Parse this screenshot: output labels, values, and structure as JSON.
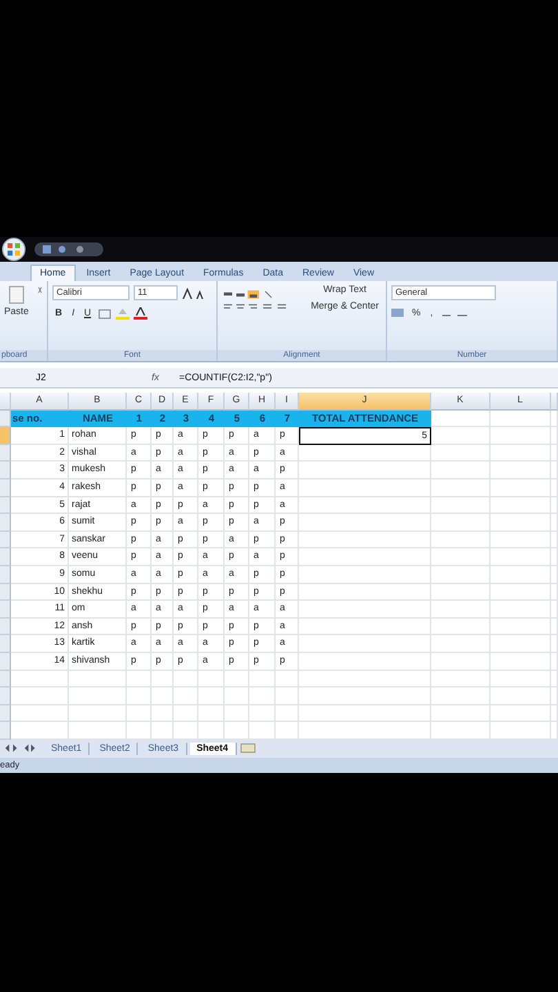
{
  "ribbon": {
    "tabs": [
      {
        "label": "Home",
        "selected": true
      },
      {
        "label": "Insert",
        "selected": false
      },
      {
        "label": "Page Layout",
        "selected": false
      },
      {
        "label": "Formulas",
        "selected": false
      },
      {
        "label": "Data",
        "selected": false
      },
      {
        "label": "Review",
        "selected": false
      },
      {
        "label": "View",
        "selected": false
      }
    ],
    "clipboard": {
      "paste": "Paste",
      "group_label": "pboard"
    },
    "font": {
      "name": "Calibri",
      "size": "11",
      "bold": "B",
      "italic": "I",
      "underline": "U",
      "group_label": "Font"
    },
    "alignment": {
      "wrap": "Wrap Text",
      "merge": "Merge & Center",
      "group_label": "Alignment"
    },
    "number": {
      "format": "General",
      "percent": "%",
      "comma": ",",
      "group_label": "Number"
    }
  },
  "formula_bar": {
    "name_box": "J2",
    "fx": "fx",
    "formula": "=COUNTIF(C2:I2,\"p\")"
  },
  "sheet": {
    "columns": [
      {
        "label": "A",
        "selected": false
      },
      {
        "label": "B",
        "selected": false
      },
      {
        "label": "C",
        "selected": false
      },
      {
        "label": "D",
        "selected": false
      },
      {
        "label": "E",
        "selected": false
      },
      {
        "label": "F",
        "selected": false
      },
      {
        "label": "G",
        "selected": false
      },
      {
        "label": "H",
        "selected": false
      },
      {
        "label": "I",
        "selected": false
      },
      {
        "label": "J",
        "selected": true
      },
      {
        "label": "K",
        "selected": false
      },
      {
        "label": "L",
        "selected": false
      }
    ],
    "header_row": [
      "se no.",
      "NAME",
      "1",
      "2",
      "3",
      "4",
      "5",
      "6",
      "7",
      "TOTAL ATTENDANCE"
    ],
    "rows": [
      {
        "no": "1",
        "name": "rohan",
        "marks": [
          "p",
          "p",
          "a",
          "p",
          "p",
          "a",
          "p"
        ],
        "total": "5",
        "selected": true
      },
      {
        "no": "2",
        "name": "vishal",
        "marks": [
          "a",
          "p",
          "a",
          "p",
          "a",
          "p",
          "a"
        ],
        "selected": false
      },
      {
        "no": "3",
        "name": "mukesh",
        "marks": [
          "p",
          "a",
          "a",
          "p",
          "a",
          "a",
          "p"
        ],
        "selected": false
      },
      {
        "no": "4",
        "name": "rakesh",
        "marks": [
          "p",
          "p",
          "a",
          "p",
          "p",
          "p",
          "a"
        ],
        "selected": false
      },
      {
        "no": "5",
        "name": "rajat",
        "marks": [
          "a",
          "p",
          "p",
          "a",
          "p",
          "p",
          "a"
        ],
        "selected": false
      },
      {
        "no": "6",
        "name": "sumit",
        "marks": [
          "p",
          "p",
          "a",
          "p",
          "p",
          "a",
          "p"
        ],
        "selected": false
      },
      {
        "no": "7",
        "name": "sanskar",
        "marks": [
          "p",
          "a",
          "p",
          "p",
          "a",
          "p",
          "p"
        ],
        "selected": false
      },
      {
        "no": "8",
        "name": "veenu",
        "marks": [
          "p",
          "a",
          "p",
          "a",
          "p",
          "a",
          "p"
        ],
        "selected": false
      },
      {
        "no": "9",
        "name": "somu",
        "marks": [
          "a",
          "a",
          "p",
          "a",
          "a",
          "p",
          "p"
        ],
        "selected": false
      },
      {
        "no": "10",
        "name": "shekhu",
        "marks": [
          "p",
          "p",
          "p",
          "p",
          "p",
          "p",
          "p"
        ],
        "selected": false
      },
      {
        "no": "11",
        "name": "om",
        "marks": [
          "a",
          "a",
          "a",
          "p",
          "a",
          "a",
          "a"
        ],
        "selected": false
      },
      {
        "no": "12",
        "name": "ansh",
        "marks": [
          "p",
          "p",
          "p",
          "p",
          "p",
          "p",
          "a"
        ],
        "selected": false
      },
      {
        "no": "13",
        "name": "kartik",
        "marks": [
          "a",
          "a",
          "a",
          "a",
          "p",
          "p",
          "a"
        ],
        "selected": false
      },
      {
        "no": "14",
        "name": "shivansh",
        "marks": [
          "p",
          "p",
          "p",
          "a",
          "p",
          "p",
          "p"
        ],
        "selected": false
      }
    ]
  },
  "sheet_tabs": [
    {
      "label": "Sheet1",
      "selected": false
    },
    {
      "label": "Sheet2",
      "selected": false
    },
    {
      "label": "Sheet3",
      "selected": false
    },
    {
      "label": "Sheet4",
      "selected": true
    }
  ],
  "status_bar": {
    "text": "eady"
  }
}
